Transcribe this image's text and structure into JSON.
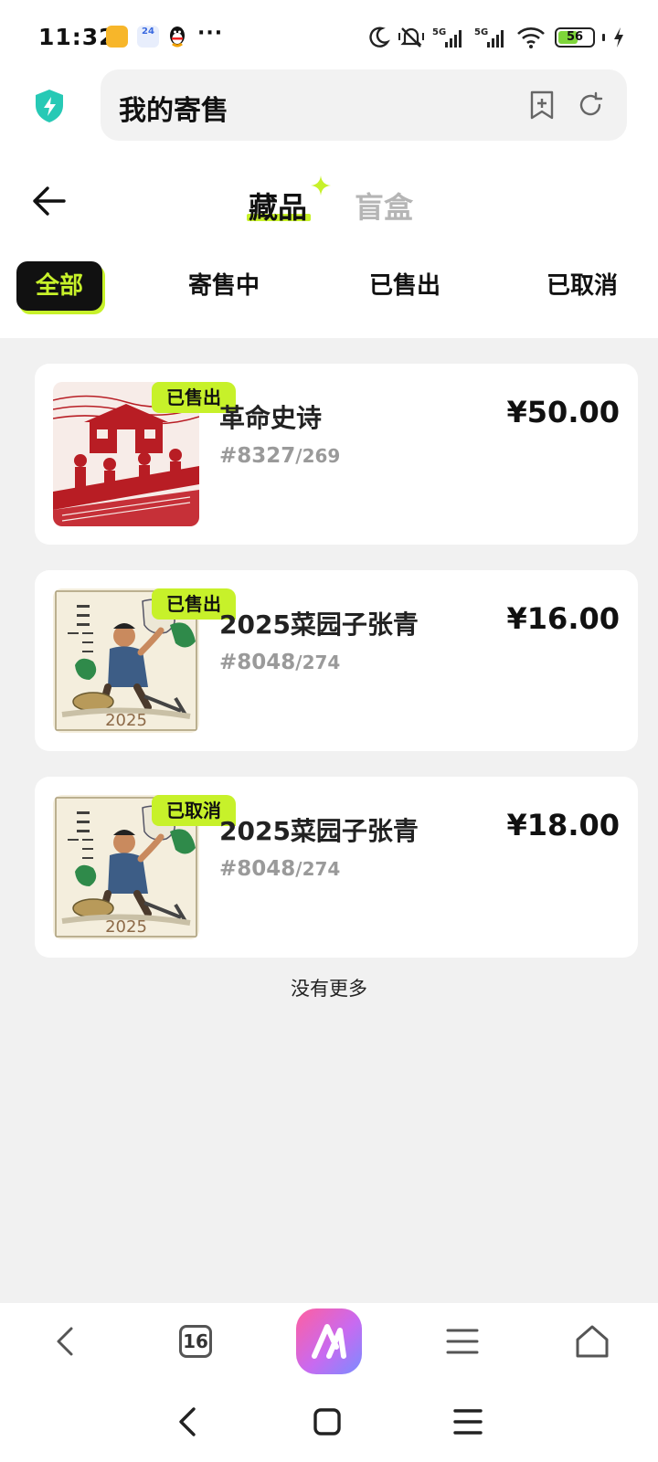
{
  "status_bar": {
    "time": "11:32",
    "calendar_day": "24",
    "more": "···",
    "battery_level": "56",
    "network_left": "5G",
    "network_right": "5G",
    "wifi_sub": "6"
  },
  "browser": {
    "url_title": "我的寄售",
    "tab_count": "16"
  },
  "header": {
    "tabs": [
      {
        "label": "藏品",
        "active": true
      },
      {
        "label": "盲盒",
        "active": false
      }
    ],
    "filters": [
      {
        "label": "全部",
        "active": true
      },
      {
        "label": "寄售中",
        "active": false
      },
      {
        "label": "已售出",
        "active": false
      },
      {
        "label": "已取消",
        "active": false
      }
    ]
  },
  "items": [
    {
      "badge": "已售出",
      "title": "革命史诗",
      "serial": "#8327",
      "total": "/269",
      "price": "¥50.00",
      "thumb": "red-papercut"
    },
    {
      "badge": "已售出",
      "title": "2025菜园子张青",
      "serial": "#8048",
      "total": "/274",
      "price": "¥16.00",
      "thumb": "farmer-illustration",
      "thumb_year": "2025"
    },
    {
      "badge": "已取消",
      "title": "2025菜园子张青",
      "serial": "#8048",
      "total": "/274",
      "price": "¥18.00",
      "thumb": "farmer-illustration",
      "thumb_year": "2025"
    }
  ],
  "footer_text": "没有更多",
  "colors": {
    "accent": "#c7f12a",
    "dark": "#111111",
    "muted": "#9a9a9a",
    "background": "#f1f1f1"
  }
}
